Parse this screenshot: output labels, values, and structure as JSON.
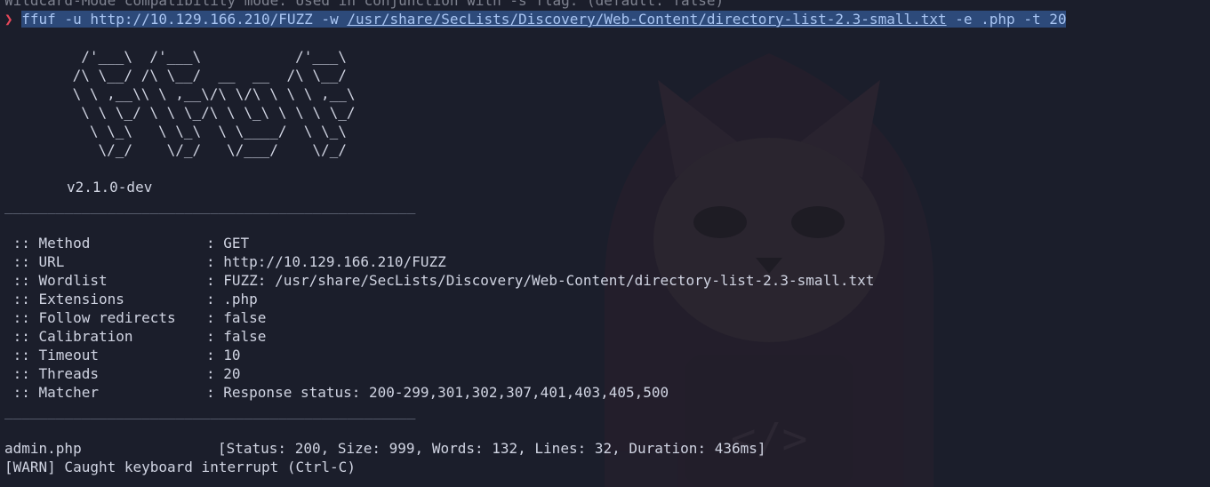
{
  "prev_line": "Wildcard-Mode compatibility mode. Used in conjunction with -s flag. (default: false)",
  "command": {
    "prompt_symbol": "❯",
    "program": "ffuf",
    "args_before": " -u http://10.129.166.210/FUZZ -w ",
    "wordlist_path": "/usr/share/SecLists/Discovery/Web-Content/directory-list-2.3-small.txt",
    "args_after": " -e .php -t 20"
  },
  "banner": [
    "  /'___\\  /'___\\           /'___\\",
    " /\\ \\__/ /\\ \\__/  __  __  /\\ \\__/",
    " \\ \\ ,__\\\\ \\ ,__\\/\\ \\/\\ \\ \\ \\ ,__\\",
    "  \\ \\ \\_/ \\ \\ \\_/\\ \\ \\_\\ \\ \\ \\ \\_/",
    "   \\ \\_\\   \\ \\_\\  \\ \\____/  \\ \\_\\",
    "    \\/_/    \\/_/   \\/___/    \\/_/"
  ],
  "version": "v2.1.0-dev",
  "separator": "________________________________________________",
  "config": [
    {
      "key": " :: Method",
      "value": ": GET"
    },
    {
      "key": " :: URL",
      "value": ": http://10.129.166.210/FUZZ"
    },
    {
      "key": " :: Wordlist",
      "value": ": FUZZ: /usr/share/SecLists/Discovery/Web-Content/directory-list-2.3-small.txt"
    },
    {
      "key": " :: Extensions",
      "value": ": .php"
    },
    {
      "key": " :: Follow redirects",
      "value": ": false"
    },
    {
      "key": " :: Calibration",
      "value": ": false"
    },
    {
      "key": " :: Timeout",
      "value": ": 10"
    },
    {
      "key": " :: Threads",
      "value": ": 20"
    },
    {
      "key": " :: Matcher",
      "value": ": Response status: 200-299,301,302,307,401,403,405,500"
    }
  ],
  "result": {
    "name": "admin.php",
    "details": "[Status: 200, Size: 999, Words: 132, Lines: 32, Duration: 436ms]"
  },
  "warning": "[WARN] Caught keyboard interrupt (Ctrl-C)",
  "colors": {
    "background": "#1b1e2b",
    "text": "#d0d4e2",
    "prompt": "#e8485a",
    "command_highlight": "#2d4a7a"
  }
}
